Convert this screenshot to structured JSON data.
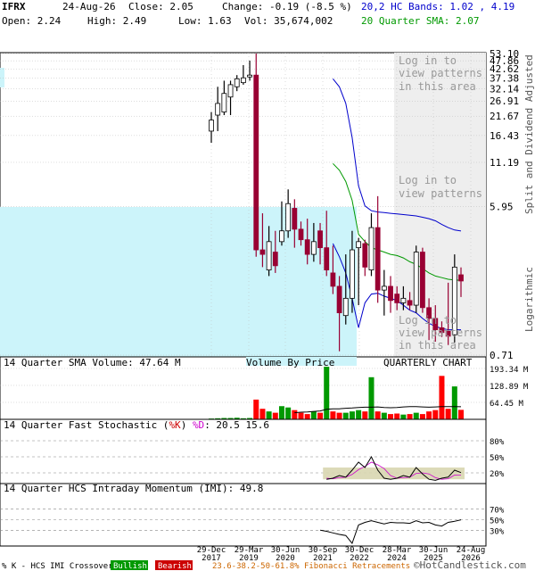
{
  "header": {
    "symbol": "IFRX",
    "date": "24-Aug-26",
    "close_label": "Close: 2.05",
    "change_label": "Change: -0.19 (-8.5 %)",
    "open_label": "Open: 2.24",
    "high_label": "High: 2.49",
    "low_label": "Low: 1.63",
    "vol_label": "Vol: 35,674,002",
    "bands_prefix": "20,2 HC Bands: ",
    "bands_value": "1.02 , 4.19",
    "sma_label": "20 Quarter SMA: 2.07"
  },
  "overlays": {
    "login_text_1": [
      "Log in to",
      "view patterns",
      "in this area"
    ],
    "login_text_2": [
      "Log in to",
      "view patterns",
      "in this area"
    ],
    "right_axis_label_top": "Split and Dividend Adjusted",
    "right_axis_label_bottom": "Logarithmic"
  },
  "colors": {
    "up": "#ffffff",
    "down": "#990033",
    "band": "#0000cc",
    "sma": "#009900",
    "vbp": "#ccf4fa",
    "grid": "#bbbbbb",
    "vol_up": "#009900",
    "vol_down": "#ff0000",
    "stoch_fill": "#d8d6b0",
    "bullish": "#009900",
    "bearish": "#cc0000",
    "fib": "#cc6600"
  },
  "chart_data": [
    {
      "name": "price",
      "type": "candlestick",
      "scale": "log",
      "y_ticks": [
        53.1,
        47.86,
        42.62,
        37.38,
        32.14,
        26.91,
        21.67,
        16.43,
        11.19,
        5.95,
        0.71
      ],
      "y_tick_labels": [
        "53.10",
        "47.86",
        "42.62",
        "37.38",
        "32.14",
        "26.91",
        "21.67",
        "16.43",
        "11.19",
        "5.95",
        "0.71"
      ],
      "x_tick_labels": [
        [
          "29-Dec",
          "2017"
        ],
        [
          "29-Mar",
          "2019"
        ],
        [
          "30-Jun",
          "2020"
        ],
        [
          "30-Sep",
          "2021"
        ],
        [
          "30-Dec",
          "2022"
        ],
        [
          "28-Mar",
          "2024"
        ],
        [
          "30-Jun",
          "2025"
        ],
        [
          "24-Aug",
          "2026"
        ]
      ],
      "candles": [
        {
          "o": 17.5,
          "h": 23.0,
          "l": 14.8,
          "c": 20.5
        },
        {
          "o": 22.0,
          "h": 33.0,
          "l": 17.5,
          "c": 26.0
        },
        {
          "o": 23.0,
          "h": 36.0,
          "l": 22.0,
          "c": 30.0
        },
        {
          "o": 28.5,
          "h": 36.0,
          "l": 22.0,
          "c": 34.0
        },
        {
          "o": 33.0,
          "h": 39.0,
          "l": 31.0,
          "c": 37.0
        },
        {
          "o": 35.0,
          "h": 45.0,
          "l": 34.0,
          "c": 37.5
        },
        {
          "o": 38.0,
          "h": 48.0,
          "l": 36.0,
          "c": 39.0
        },
        {
          "o": 39.0,
          "h": 53.1,
          "l": 2.9,
          "c": 3.2
        },
        {
          "o": 3.2,
          "h": 5.4,
          "l": 2.5,
          "c": 3.0
        },
        {
          "o": 2.4,
          "h": 4.5,
          "l": 2.2,
          "c": 3.6
        },
        {
          "o": 3.1,
          "h": 4.2,
          "l": 2.3,
          "c": 2.55
        },
        {
          "o": 3.6,
          "h": 6.4,
          "l": 3.4,
          "c": 4.2
        },
        {
          "o": 4.2,
          "h": 7.6,
          "l": 3.8,
          "c": 6.2
        },
        {
          "o": 5.8,
          "h": 6.6,
          "l": 3.3,
          "c": 4.3
        },
        {
          "o": 4.3,
          "h": 4.8,
          "l": 3.4,
          "c": 3.7
        },
        {
          "o": 3.7,
          "h": 5.0,
          "l": 2.6,
          "c": 3.0
        },
        {
          "o": 3.0,
          "h": 4.7,
          "l": 2.7,
          "c": 3.6
        },
        {
          "o": 4.2,
          "h": 4.7,
          "l": 2.6,
          "c": 3.3
        },
        {
          "o": 3.3,
          "h": 5.6,
          "l": 2.2,
          "c": 2.4
        },
        {
          "o": 2.3,
          "h": 3.4,
          "l": 1.7,
          "c": 1.9
        },
        {
          "o": 1.9,
          "h": 2.2,
          "l": 0.75,
          "c": 1.3
        },
        {
          "o": 1.25,
          "h": 3.0,
          "l": 1.1,
          "c": 1.6
        },
        {
          "o": 1.6,
          "h": 4.2,
          "l": 1.3,
          "c": 3.2
        },
        {
          "o": 3.3,
          "h": 3.8,
          "l": 1.45,
          "c": 3.6
        },
        {
          "o": 3.5,
          "h": 3.7,
          "l": 2.2,
          "c": 2.5
        },
        {
          "o": 2.4,
          "h": 5.4,
          "l": 2.2,
          "c": 4.4
        },
        {
          "o": 4.4,
          "h": 6.9,
          "l": 1.5,
          "c": 1.8
        },
        {
          "o": 1.8,
          "h": 2.4,
          "l": 1.25,
          "c": 1.9
        },
        {
          "o": 1.9,
          "h": 2.2,
          "l": 1.3,
          "c": 1.55
        },
        {
          "o": 1.7,
          "h": 1.9,
          "l": 1.35,
          "c": 1.5
        },
        {
          "o": 1.5,
          "h": 1.9,
          "l": 1.35,
          "c": 1.6
        },
        {
          "o": 1.55,
          "h": 1.75,
          "l": 1.35,
          "c": 1.45
        },
        {
          "o": 1.45,
          "h": 3.4,
          "l": 1.3,
          "c": 3.1
        },
        {
          "o": 3.1,
          "h": 3.3,
          "l": 1.3,
          "c": 1.4
        },
        {
          "o": 1.4,
          "h": 1.6,
          "l": 0.88,
          "c": 1.2
        },
        {
          "o": 1.2,
          "h": 1.45,
          "l": 0.86,
          "c": 1.02
        },
        {
          "o": 1.05,
          "h": 1.15,
          "l": 0.92,
          "c": 0.98
        },
        {
          "o": 1.0,
          "h": 2.0,
          "l": 0.82,
          "c": 0.93
        },
        {
          "o": 0.95,
          "h": 3.0,
          "l": 0.85,
          "c": 2.5
        },
        {
          "o": 2.24,
          "h": 2.49,
          "l": 1.63,
          "c": 2.05
        }
      ],
      "upper_band": [
        null,
        null,
        null,
        null,
        null,
        null,
        null,
        null,
        null,
        null,
        null,
        null,
        null,
        null,
        null,
        null,
        null,
        null,
        null,
        37.0,
        33.0,
        26.0,
        16.0,
        8.0,
        6.0,
        5.6,
        5.5,
        5.45,
        5.4,
        5.35,
        5.3,
        5.25,
        5.2,
        5.1,
        5.0,
        4.85,
        4.6,
        4.4,
        4.25,
        4.19
      ],
      "lower_band": [
        null,
        null,
        null,
        null,
        null,
        null,
        null,
        null,
        null,
        null,
        null,
        null,
        null,
        null,
        null,
        null,
        null,
        null,
        null,
        3.5,
        2.9,
        2.3,
        1.6,
        1.05,
        1.5,
        1.7,
        1.72,
        1.65,
        1.6,
        1.55,
        1.45,
        1.35,
        1.3,
        1.2,
        1.12,
        1.07,
        1.04,
        1.02,
        1.02,
        1.02
      ],
      "sma": [
        null,
        null,
        null,
        null,
        null,
        null,
        null,
        null,
        null,
        null,
        null,
        null,
        null,
        null,
        null,
        null,
        null,
        null,
        null,
        11.0,
        10.0,
        8.5,
        6.5,
        4.0,
        3.6,
        3.3,
        3.2,
        3.1,
        3.0,
        2.95,
        2.85,
        2.7,
        2.6,
        2.45,
        2.3,
        2.2,
        2.15,
        2.1,
        2.08,
        2.07
      ]
    },
    {
      "name": "volume",
      "type": "bar",
      "title": "14 Quarter SMA Volume: 47.64 M",
      "y_ticks": [
        193.34,
        128.89,
        64.45
      ],
      "y_tick_labels": [
        "193.34 M",
        "128.89 M",
        "64.45 M"
      ],
      "ylim": [
        0,
        200
      ],
      "values": [
        3,
        4,
        5,
        5,
        6,
        4,
        5,
        75,
        40,
        30,
        25,
        50,
        45,
        35,
        25,
        20,
        30,
        25,
        200,
        30,
        25,
        25,
        30,
        35,
        30,
        160,
        30,
        25,
        20,
        22,
        18,
        20,
        25,
        20,
        30,
        35,
        165,
        40,
        125,
        36
      ],
      "down": [
        false,
        false,
        false,
        false,
        false,
        false,
        false,
        true,
        true,
        false,
        true,
        false,
        false,
        true,
        true,
        true,
        false,
        true,
        false,
        true,
        true,
        false,
        false,
        false,
        true,
        false,
        true,
        false,
        true,
        true,
        false,
        true,
        false,
        true,
        true,
        true,
        true,
        true,
        false,
        true
      ],
      "sma": [
        null,
        null,
        null,
        null,
        null,
        null,
        null,
        null,
        null,
        null,
        null,
        null,
        null,
        25,
        27,
        28,
        30,
        32,
        38,
        40,
        40,
        42,
        43,
        45,
        46,
        46,
        47,
        45,
        44,
        45,
        47,
        48,
        48,
        47,
        46,
        47,
        48,
        48,
        48,
        47.64
      ]
    },
    {
      "name": "stochastic",
      "type": "line",
      "title_prefix": "14 Quarter Fast Stochastic (",
      "title_k": "%K",
      "title_mid": ") ",
      "title_d": "%D",
      "title_suffix": ": 20.5  15.6",
      "y_ticks": [
        80,
        50,
        20
      ],
      "y_tick_labels": [
        "80%",
        "50%",
        "20%"
      ],
      "ylim": [
        0,
        100
      ],
      "k": [
        null,
        null,
        null,
        null,
        null,
        null,
        null,
        null,
        null,
        null,
        null,
        null,
        null,
        null,
        null,
        null,
        null,
        null,
        8,
        10,
        15,
        12,
        25,
        40,
        30,
        50,
        25,
        10,
        8,
        10,
        15,
        12,
        30,
        18,
        8,
        6,
        10,
        12,
        25,
        20.5
      ],
      "d": [
        null,
        null,
        null,
        null,
        null,
        null,
        null,
        null,
        null,
        null,
        null,
        null,
        null,
        null,
        null,
        null,
        null,
        null,
        10,
        9,
        11,
        12,
        17,
        26,
        32,
        40,
        35,
        28,
        15,
        10,
        11,
        12,
        19,
        20,
        18,
        11,
        8,
        9,
        16,
        15.6
      ]
    },
    {
      "name": "momentum",
      "type": "line",
      "title": "14 Quarter HCS Intraday Momentum (IMI): 49.8",
      "y_ticks": [
        70,
        50,
        30
      ],
      "y_tick_labels": [
        "70%",
        "50%",
        "30%"
      ],
      "ylim": [
        0,
        100
      ],
      "values": [
        null,
        null,
        null,
        null,
        null,
        null,
        null,
        null,
        null,
        null,
        null,
        null,
        null,
        null,
        null,
        null,
        null,
        30,
        28,
        25,
        22,
        20,
        5,
        40,
        45,
        48,
        45,
        42,
        45,
        44,
        44,
        43,
        48,
        44,
        45,
        40,
        38,
        45,
        47,
        49.8
      ]
    }
  ],
  "footer": {
    "crossover_label": "% K - HCS IMI Crossover,",
    "bullish": "Bullish",
    "bearish": "Bearish",
    "fib_label": "23.6-38.2-50-61.8% Fibonacci Retracements",
    "watermark": "©HotCandlestick.com"
  },
  "labels": {
    "vbp": "Volume By Price",
    "quarterly": "QUARTERLY CHART"
  }
}
